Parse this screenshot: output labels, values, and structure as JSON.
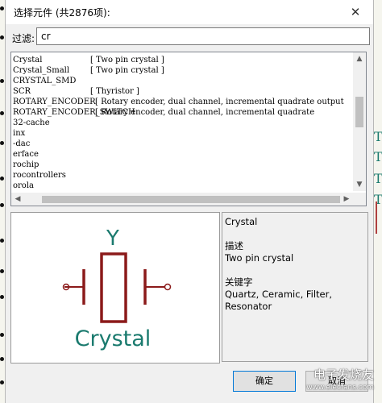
{
  "dialog": {
    "title": "选择元件 (共2876项):",
    "close_glyph": "✕"
  },
  "filter": {
    "label": "过滤:",
    "value": "cr"
  },
  "list": {
    "rows": [
      {
        "name": "Crystal",
        "desc": "[ Two pin crystal ]"
      },
      {
        "name": "Crystal_Small",
        "desc": "[ Two pin crystal ]"
      },
      {
        "name": "CRYSTAL_SMD",
        "desc": ""
      },
      {
        "name": "SCR",
        "desc": "[ Thyristor ]"
      },
      {
        "name": "ROTARY_ENCODER",
        "desc": "[ Rotary encoder, dual channel, incremental quadrate output"
      },
      {
        "name": "ROTARY_ENCODER_SWITCH",
        "desc": "[ Rotary encoder, dual channel, incremental quadrate"
      },
      {
        "name": "32-cache",
        "desc": ""
      },
      {
        "name": "inx",
        "desc": ""
      },
      {
        "name": "-dac",
        "desc": ""
      },
      {
        "name": "erface",
        "desc": ""
      },
      {
        "name": "rochip",
        "desc": ""
      },
      {
        "name": "rocontrollers",
        "desc": ""
      },
      {
        "name": "orola",
        "desc": ""
      }
    ]
  },
  "preview": {
    "reference": "Y",
    "value": "Crystal",
    "symbol_color": "#8b1a1a",
    "text_color": "#1a7a6e"
  },
  "info": {
    "name": "Crystal",
    "desc_heading": "描述",
    "desc": "Two pin crystal",
    "keywords_heading": "关键字",
    "keywords": "Quartz, Ceramic, Filter, Resonator"
  },
  "buttons": {
    "ok": "确定",
    "cancel": "取消"
  },
  "watermark": {
    "text": "电子发烧友",
    "sub": "www.elecfans.com"
  }
}
